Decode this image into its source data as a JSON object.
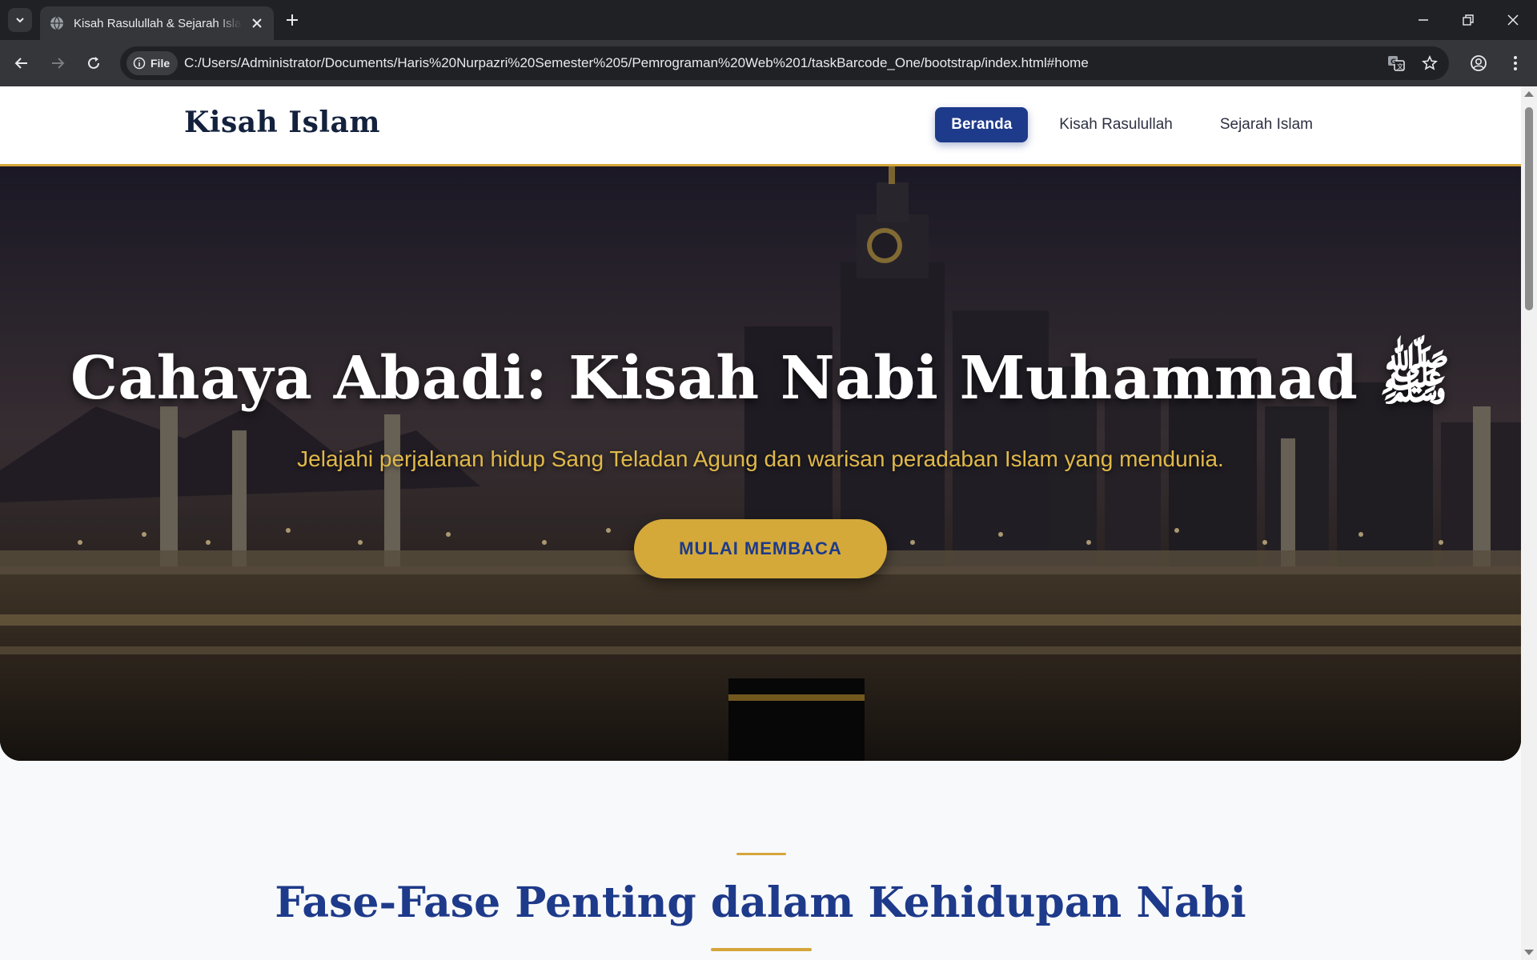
{
  "browser": {
    "tab_title": "Kisah Rasulullah & Sejarah Islam",
    "file_chip": "File",
    "url": "C:/Users/Administrator/Documents/Haris%20Nurpazri%20Semester%205/Pemrograman%20Web%201/taskBarcode_One/bootstrap/index.html#home"
  },
  "navbar": {
    "brand": "Kisah Islam",
    "links": [
      {
        "label": "Beranda",
        "active": true
      },
      {
        "label": "Kisah Rasulullah",
        "active": false
      },
      {
        "label": "Sejarah Islam",
        "active": false
      }
    ]
  },
  "hero": {
    "title": "Cahaya Abadi: Kisah Nabi Muhammad ﷺ",
    "subtitle": "Jelajahi perjalanan hidup Sang Teladan Agung dan warisan peradaban Islam yang mendunia.",
    "button": "MULAI MEMBACA"
  },
  "section": {
    "title": "Fase-Fase Penting dalam Kehidupan Nabi"
  },
  "colors": {
    "primary": "#1e3a8a",
    "accent": "#d4a53a",
    "brand_text": "#14213d"
  }
}
